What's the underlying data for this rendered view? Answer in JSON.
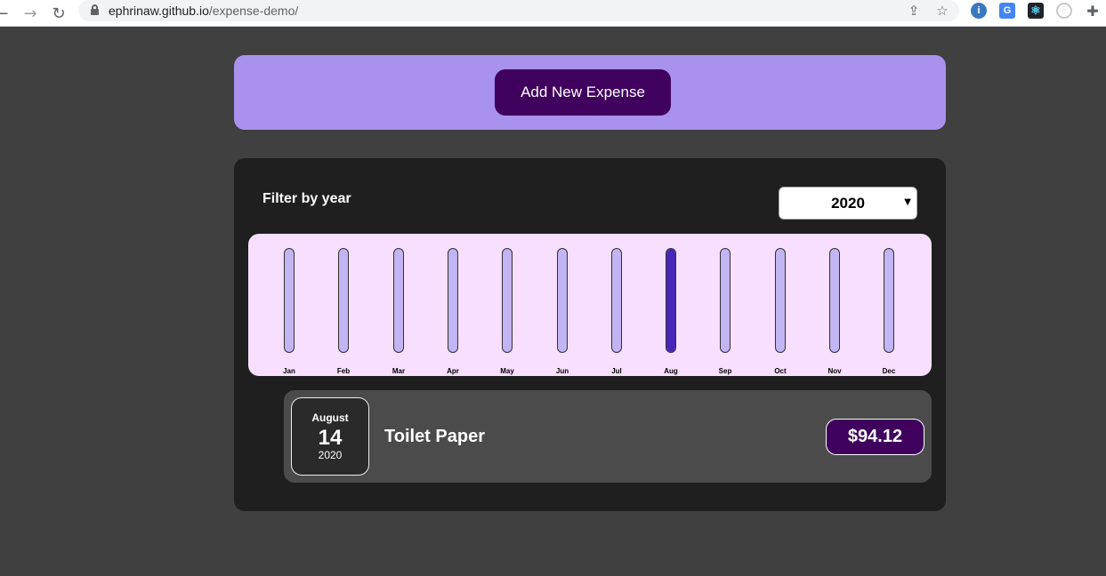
{
  "browser": {
    "url_host": "ephrinaw.github.io",
    "url_path": "/expense-demo/",
    "icons": [
      "back-arrow-icon",
      "forward-arrow-icon",
      "reload-icon",
      "lock-icon",
      "share-icon",
      "star-icon",
      "puzzle-extensions-icon"
    ]
  },
  "new_expense": {
    "button_label": "Add New Expense"
  },
  "filter": {
    "label": "Filter by year",
    "selected_year": "2020"
  },
  "chart_data": {
    "type": "bar",
    "categories": [
      "Jan",
      "Feb",
      "Mar",
      "Apr",
      "May",
      "Jun",
      "Jul",
      "Aug",
      "Sep",
      "Oct",
      "Nov",
      "Dec"
    ],
    "values": [
      0,
      0,
      0,
      0,
      0,
      0,
      0,
      1,
      0,
      0,
      0,
      0
    ],
    "fill_fractions": [
      0,
      0,
      0,
      0,
      0,
      0,
      0,
      1,
      0,
      0,
      0,
      0
    ],
    "colors": {
      "track": "#c3b4f3",
      "fill": "#4826b9",
      "background": "#f8dfff"
    }
  },
  "expenses": [
    {
      "month": "August",
      "day": "14",
      "year": "2020",
      "title": "Toilet Paper",
      "amount": "$94.12"
    }
  ],
  "colors": {
    "page_bg": "#404040",
    "panel_bg": "#1f1f1f",
    "accent_purple": "#a892ee",
    "dark_purple": "#40005d",
    "item_bg": "#4b4b4b"
  }
}
